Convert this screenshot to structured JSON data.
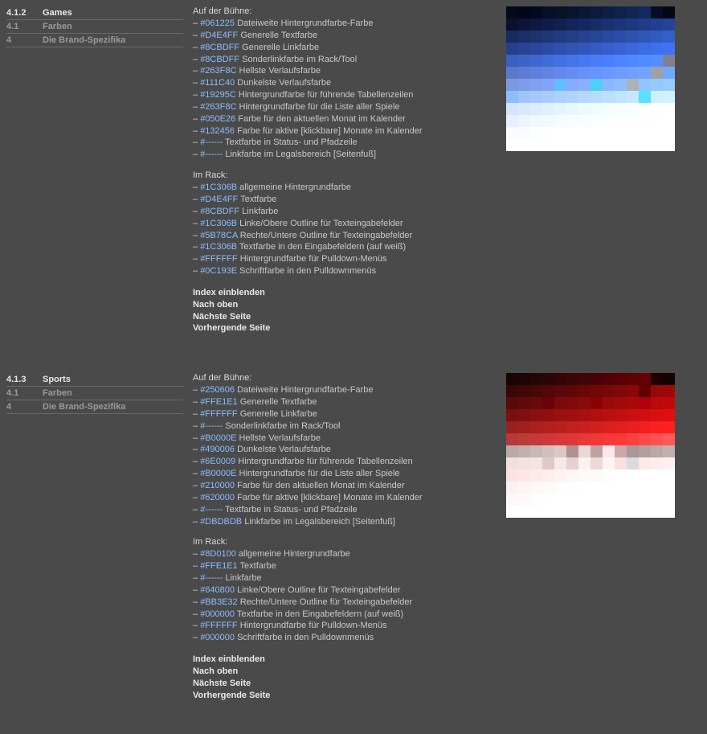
{
  "sections": [
    {
      "id": "games",
      "nav": [
        {
          "num": "4.1.2",
          "label": "Games",
          "active": true
        },
        {
          "num": "4.1",
          "label": "Farben",
          "active": false
        },
        {
          "num": "4",
          "label": "Die Brand-Spezifika",
          "active": false
        }
      ],
      "group1_heading": "Auf der Bühne:",
      "group1": [
        {
          "hex": "#061225",
          "desc": "Dateiweite Hintergrundfarbe-Farbe"
        },
        {
          "hex": "#D4E4FF",
          "desc": "Generelle Textfarbe"
        },
        {
          "hex": "#8CBDFF",
          "desc": "Generelle Linkfarbe"
        },
        {
          "hex": "#8CBDFF",
          "desc": "Sonderlinkfarbe im Rack/Tool"
        },
        {
          "hex": "#263F8C",
          "desc": "Hellste Verlaufsfarbe"
        },
        {
          "hex": "#111C40",
          "desc": "Dunkelste Verlaufsfarbe"
        },
        {
          "hex": "#19295C",
          "desc": "Hintergrundfarbe für führende Tabellenzeilen"
        },
        {
          "hex": "#263F8C",
          "desc": "Hintergrundfarbe für die Liste aller Spiele"
        },
        {
          "hex": "#050E26",
          "desc": "Farbe für den aktuellen Monat im Kalender"
        },
        {
          "hex": "#132456",
          "desc": "Farbe für aktive [klickbare] Monate im Kalender"
        },
        {
          "hex": "#------",
          "desc": "Textfarbe in Status- und Pfadzeile"
        },
        {
          "hex": "#------",
          "desc": "Linkfarbe im Legalsbereich [Seitenfuß]"
        }
      ],
      "group2_heading": "Im Rack:",
      "group2": [
        {
          "hex": "#1C306B",
          "desc": "allgemeine Hintergrundfarbe"
        },
        {
          "hex": "#D4E4FF",
          "desc": "Textfarbe"
        },
        {
          "hex": "#8CBDFF",
          "desc": "Linkfarbe"
        },
        {
          "hex": "#1C306B",
          "desc": "Linke/Obere Outline für Texteingabefelder"
        },
        {
          "hex": "#5B78CA",
          "desc": "Rechte/Untere Outline für Texteingabefelder"
        },
        {
          "hex": "#1C306B",
          "desc": "Textfarbe in den Eingabefeldern (auf weiß)"
        },
        {
          "hex": "#FFFFFF",
          "desc": "Hintergrundfarbe für Pulldown-Menüs"
        },
        {
          "hex": "#0C193E",
          "desc": "Schriftfarbe in den Pulldownmenüs"
        }
      ],
      "navlinks": [
        "Index einblenden",
        "Nach oben",
        "Nächste Seite",
        "Vorhergende Seite"
      ],
      "swatches": [
        "#040a18",
        "#030818",
        "#030a1e",
        "#05102a",
        "#061225",
        "#08142e",
        "#0a1735",
        "#0c1a3c",
        "#0e1e44",
        "#10224c",
        "#122554",
        "#14295c",
        "#050e26",
        "#030814",
        "#0a1030",
        "#0c1438",
        "#0e1840",
        "#101c48",
        "#122050",
        "#142458",
        "#162860",
        "#182c68",
        "#1a3070",
        "#1c3478",
        "#1e3880",
        "#203c88",
        "#224090",
        "#244498",
        "#1a2a60",
        "#1c2e68",
        "#1e3270",
        "#203678",
        "#223a80",
        "#243e88",
        "#264290",
        "#284698",
        "#2a4aa0",
        "#2c4ea8",
        "#2e52b0",
        "#3056b8",
        "#325ac0",
        "#345ec8",
        "#263f8c",
        "#284394",
        "#2a479c",
        "#2c4ba4",
        "#2e4fac",
        "#3053b4",
        "#3257bc",
        "#345bc4",
        "#365fcc",
        "#3863d4",
        "#3a67dc",
        "#3c6be4",
        "#3e6fec",
        "#4073f4",
        "#3a60c0",
        "#3c64c8",
        "#3e68d0",
        "#406cd8",
        "#4270e0",
        "#4474e8",
        "#4678f0",
        "#487cf8",
        "#4a80ff",
        "#4c84ff",
        "#4e88ff",
        "#508cff",
        "#5290ff",
        "#808090",
        "#5b78ca",
        "#5d7cd2",
        "#5f80da",
        "#6184e2",
        "#6388ea",
        "#658cf2",
        "#6790fa",
        "#6994ff",
        "#6b98ff",
        "#6d9cff",
        "#6fa0ff",
        "#71a4ff",
        "#a0a0a8",
        "#73a8ff",
        "#7c98e0",
        "#7e9ce8",
        "#80a0f0",
        "#82a4f8",
        "#60c0ff",
        "#86acff",
        "#88b0ff",
        "#4cd0f8",
        "#8cb8ff",
        "#8ebcff",
        "#b0b0b8",
        "#92c4ff",
        "#94c8ff",
        "#96ccff",
        "#8cbdff",
        "#a0c4ff",
        "#a4c8ff",
        "#a8ccff",
        "#acd0ff",
        "#b0d4ff",
        "#b4d8ff",
        "#b8dcff",
        "#bce0ff",
        "#c0e4ff",
        "#c4e8ff",
        "#58e0ff",
        "#ccf0ff",
        "#d0f4ff",
        "#d4e4ff",
        "#d8e8ff",
        "#dcecff",
        "#e0f0ff",
        "#e4f4ff",
        "#e8f8ff",
        "#ecfbff",
        "#f0fdff",
        "#f4feff",
        "#f6ffff",
        "#f8ffff",
        "#faffff",
        "#fcffff",
        "#feffff",
        "#e8f0ff",
        "#ecf4ff",
        "#f0f8ff",
        "#f2faff",
        "#f4fcff",
        "#f6fdff",
        "#f8feff",
        "#faffff",
        "#fcffff",
        "#fdffff",
        "#feffff",
        "#feffff",
        "#ffffff",
        "#ffffff",
        "#f8fbff",
        "#fafdff",
        "#fcfeff",
        "#fdfeff",
        "#feffff",
        "#feffff",
        "#ffffff",
        "#ffffff",
        "#ffffff",
        "#ffffff",
        "#ffffff",
        "#ffffff",
        "#ffffff",
        "#ffffff",
        "#ffffff",
        "#ffffff",
        "#ffffff",
        "#ffffff",
        "#ffffff",
        "#ffffff",
        "#ffffff",
        "#ffffff",
        "#ffffff",
        "#ffffff",
        "#ffffff",
        "#ffffff",
        "#ffffff",
        "#ffffff"
      ]
    },
    {
      "id": "sports",
      "nav": [
        {
          "num": "4.1.3",
          "label": "Sports",
          "active": true
        },
        {
          "num": "4.1",
          "label": "Farben",
          "active": false
        },
        {
          "num": "4",
          "label": "Die Brand-Spezifika",
          "active": false
        }
      ],
      "group1_heading": "Auf der Bühne:",
      "group1": [
        {
          "hex": "#250606",
          "desc": "Dateiweite Hintergrundfarbe-Farbe"
        },
        {
          "hex": "#FFE1E1",
          "desc": "Generelle Textfarbe"
        },
        {
          "hex": "#FFFFFF",
          "desc": "Generelle Linkfarbe"
        },
        {
          "hex": "#------",
          "desc": "Sonderlinkfarbe im Rack/Tool"
        },
        {
          "hex": "#B0000E",
          "desc": "Hellste Verlaufsfarbe"
        },
        {
          "hex": "#490006",
          "desc": "Dunkelste Verlaufsfarbe"
        },
        {
          "hex": "#6E0009",
          "desc": "Hintergrundfarbe für führende Tabellenzeilen"
        },
        {
          "hex": "#B0000E",
          "desc": "Hintergrundfarbe für die Liste aller Spiele"
        },
        {
          "hex": "#210000",
          "desc": "Farbe für den aktuellen Monat im Kalender"
        },
        {
          "hex": "#620000",
          "desc": "Farbe für aktive [klickbare] Monate im Kalender"
        },
        {
          "hex": "#------",
          "desc": "Textfarbe in Status- und Pfadzeile"
        },
        {
          "hex": "#DBDBDB",
          "desc": "Linkfarbe im Legalsbereich [Seitenfuß]"
        }
      ],
      "group2_heading": "Im Rack:",
      "group2": [
        {
          "hex": "#8D0100",
          "desc": "allgemeine Hintergrundfarbe"
        },
        {
          "hex": "#FFE1E1",
          "desc": "Textfarbe"
        },
        {
          "hex": "#------",
          "desc": "Linkfarbe"
        },
        {
          "hex": "#640800",
          "desc": "Linke/Obere Outline für Texteingabefelder"
        },
        {
          "hex": "#BB3E32",
          "desc": "Rechte/Untere Outline für Texteingabefelder"
        },
        {
          "hex": "#000000",
          "desc": "Textfarbe in den Eingabefeldern (auf weiß)"
        },
        {
          "hex": "#FFFFFF",
          "desc": "Hintergrundfarbe für Pulldown-Menüs"
        },
        {
          "hex": "#000000",
          "desc": "Schriftfarbe in den Pulldownmenüs"
        }
      ],
      "navlinks": [
        "Index einblenden",
        "Nach oben",
        "Nächste Seite",
        "Vorhergende Seite"
      ],
      "swatches": [
        "#180404",
        "#1e0404",
        "#250606",
        "#2c0606",
        "#330606",
        "#3a0606",
        "#410606",
        "#490006",
        "#500006",
        "#570006",
        "#5e0006",
        "#650006",
        "#210000",
        "#140303",
        "#380808",
        "#400808",
        "#480808",
        "#500808",
        "#580808",
        "#600808",
        "#680808",
        "#700808",
        "#780808",
        "#800808",
        "#880808",
        "#620000",
        "#980808",
        "#a00808",
        "#580a0a",
        "#600a0a",
        "#680a0a",
        "#6e0009",
        "#780a0a",
        "#800a0a",
        "#880a0a",
        "#8d0100",
        "#980a0a",
        "#a00a0a",
        "#a80a0a",
        "#b0000e",
        "#b80a0a",
        "#c00a0a",
        "#781010",
        "#801010",
        "#881010",
        "#901010",
        "#981010",
        "#a01010",
        "#a81010",
        "#b01010",
        "#b81010",
        "#c01010",
        "#c81010",
        "#d01010",
        "#d81010",
        "#e01010",
        "#982020",
        "#a02020",
        "#a82020",
        "#b02020",
        "#b82020",
        "#c02020",
        "#c82020",
        "#d02020",
        "#d82020",
        "#e02020",
        "#e82020",
        "#f02020",
        "#f82020",
        "#ff2020",
        "#b83838",
        "#bb3e32",
        "#c83838",
        "#d03838",
        "#d83838",
        "#e03838",
        "#e83838",
        "#f03838",
        "#f83838",
        "#ff3838",
        "#ff4040",
        "#ff4848",
        "#ff5050",
        "#ff5858",
        "#b8a8a8",
        "#c0b0b0",
        "#c8b8b8",
        "#d0c0c0",
        "#d8c8c8",
        "#b09090",
        "#e8d8d8",
        "#c0a0a0",
        "#f8e8e8",
        "#c8a8a8",
        "#a89898",
        "#b0a0a0",
        "#b8a8a8",
        "#c0b0b0",
        "#f0e0e0",
        "#f2e2e2",
        "#f4e4e4",
        "#e0c8c8",
        "#f8e8e8",
        "#e8d0d0",
        "#fcf0f0",
        "#f0d8d8",
        "#fff4f4",
        "#f8e0e0",
        "#dbdbdb",
        "#ffe8e8",
        "#ffecec",
        "#fff0f0",
        "#ffe1e1",
        "#ffe6e6",
        "#ffeaea",
        "#ffeeee",
        "#fff2f2",
        "#fff6f6",
        "#fff8f8",
        "#fffafa",
        "#fffcfc",
        "#fffefe",
        "#ffffff",
        "#ffffff",
        "#ffffff",
        "#ffffff",
        "#fff0f0",
        "#fff4f4",
        "#fff8f8",
        "#fffafa",
        "#fffcfc",
        "#fffefe",
        "#ffffff",
        "#ffffff",
        "#ffffff",
        "#ffffff",
        "#ffffff",
        "#ffffff",
        "#ffffff",
        "#ffffff",
        "#fff8f8",
        "#fffafa",
        "#fffcfc",
        "#fffefe",
        "#ffffff",
        "#ffffff",
        "#ffffff",
        "#ffffff",
        "#ffffff",
        "#ffffff",
        "#ffffff",
        "#ffffff",
        "#ffffff",
        "#ffffff",
        "#ffffff",
        "#ffffff",
        "#ffffff",
        "#ffffff",
        "#ffffff",
        "#ffffff",
        "#ffffff",
        "#ffffff",
        "#ffffff",
        "#ffffff",
        "#ffffff",
        "#ffffff",
        "#ffffff",
        "#ffffff"
      ]
    }
  ]
}
